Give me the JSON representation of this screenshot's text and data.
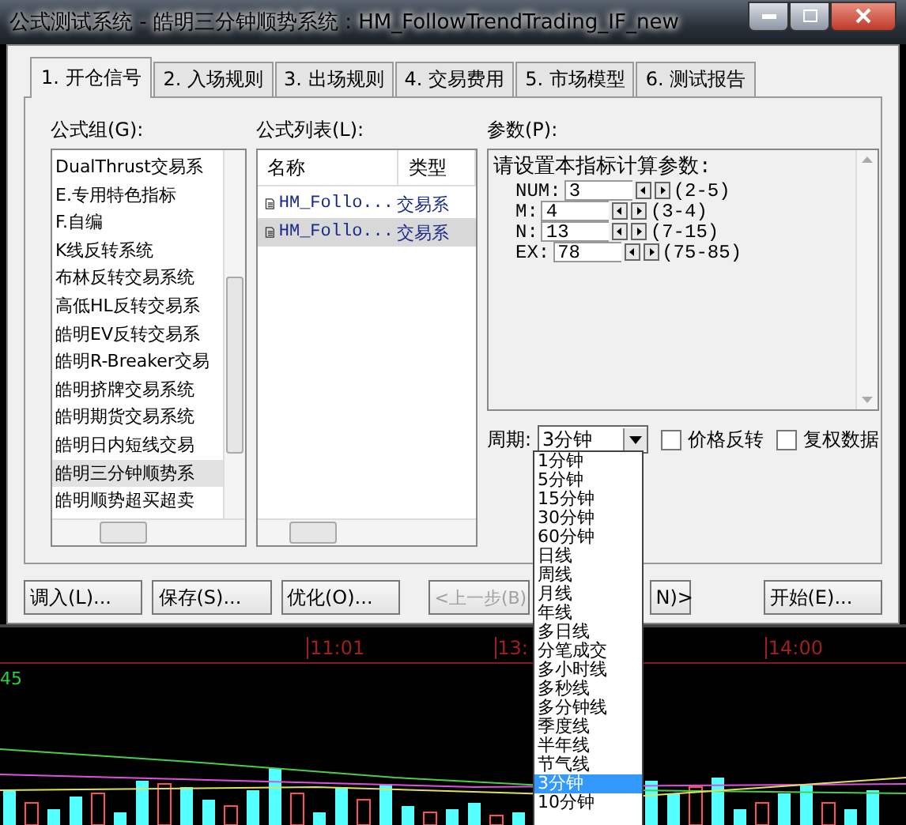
{
  "window": {
    "title": "公式测试系统 - 皓明三分钟顺势系统 : HM_FollowTrendTrading_IF_new"
  },
  "tabs": [
    {
      "label": "1. 开仓信号",
      "selected": true
    },
    {
      "label": "2. 入场规则",
      "selected": false
    },
    {
      "label": "3. 出场规则",
      "selected": false
    },
    {
      "label": "4. 交易费用",
      "selected": false
    },
    {
      "label": "5. 市场模型",
      "selected": false
    },
    {
      "label": "6. 测试报告",
      "selected": false
    }
  ],
  "formula_groups": {
    "label": "公式组(G):",
    "items": [
      {
        "label": "DualThrust交易系",
        "selected": false
      },
      {
        "label": "E.专用特色指标",
        "selected": false
      },
      {
        "label": "F.自编",
        "selected": false
      },
      {
        "label": "K线反转系统",
        "selected": false
      },
      {
        "label": "布林反转交易系统",
        "selected": false
      },
      {
        "label": "高低HL反转交易系",
        "selected": false
      },
      {
        "label": "皓明EV反转交易系",
        "selected": false
      },
      {
        "label": "皓明R-Breaker交易",
        "selected": false
      },
      {
        "label": "皓明挤牌交易系统",
        "selected": false
      },
      {
        "label": "皓明期货交易系统",
        "selected": false
      },
      {
        "label": "皓明日内短线交易",
        "selected": false
      },
      {
        "label": "皓明三分钟顺势系",
        "selected": true
      },
      {
        "label": "皓明顺势超买超卖",
        "selected": false
      }
    ]
  },
  "formula_list": {
    "label": "公式列表(L):",
    "columns": [
      "名称",
      "类型"
    ],
    "rows": [
      {
        "name": "HM_Follo...",
        "type": "交易系",
        "selected": false
      },
      {
        "name": "HM_Follo...",
        "type": "交易系",
        "selected": true
      }
    ]
  },
  "params": {
    "label": "参数(P):",
    "heading": "请设置本指标计算参数:",
    "rows": [
      {
        "name": "NUM:",
        "value": "3",
        "range": "(2-5)"
      },
      {
        "name": "M:",
        "value": "4",
        "range": "(3-4)"
      },
      {
        "name": "N:",
        "value": "13",
        "range": "(7-15)"
      },
      {
        "name": "EX:",
        "value": "78",
        "range": "(75-85)"
      }
    ]
  },
  "period": {
    "label": "周期:",
    "value": "3分钟"
  },
  "checkboxes": [
    {
      "label": "价格反转",
      "checked": false
    },
    {
      "label": "复权数据",
      "checked": false
    }
  ],
  "buttons": [
    {
      "label": "调入(L)...",
      "disabled": false
    },
    {
      "label": "保存(S)...",
      "disabled": false
    },
    {
      "label": "优化(O)...",
      "disabled": false
    },
    {
      "label": "<上一步(B)",
      "disabled": true
    },
    {
      "label": "N)>",
      "disabled": false
    },
    {
      "label": "开始(E)...",
      "disabled": false
    }
  ],
  "period_dropdown": {
    "items": [
      {
        "label": "1分钟",
        "selected": false
      },
      {
        "label": "5分钟",
        "selected": false
      },
      {
        "label": "15分钟",
        "selected": false
      },
      {
        "label": "30分钟",
        "selected": false
      },
      {
        "label": "60分钟",
        "selected": false
      },
      {
        "label": "日线",
        "selected": false
      },
      {
        "label": "周线",
        "selected": false
      },
      {
        "label": "月线",
        "selected": false
      },
      {
        "label": "年线",
        "selected": false
      },
      {
        "label": "多日线",
        "selected": false
      },
      {
        "label": "分笔成交",
        "selected": false
      },
      {
        "label": "多小时线",
        "selected": false
      },
      {
        "label": "多秒线",
        "selected": false
      },
      {
        "label": "多分钟线",
        "selected": false
      },
      {
        "label": "季度线",
        "selected": false
      },
      {
        "label": "半年线",
        "selected": false
      },
      {
        "label": "节气线",
        "selected": false
      },
      {
        "label": "3分钟",
        "selected": true
      },
      {
        "label": "10分钟",
        "selected": false
      }
    ]
  },
  "chart": {
    "time_labels": [
      "11:01",
      "13:",
      "14:00"
    ],
    "value_label": "45"
  }
}
